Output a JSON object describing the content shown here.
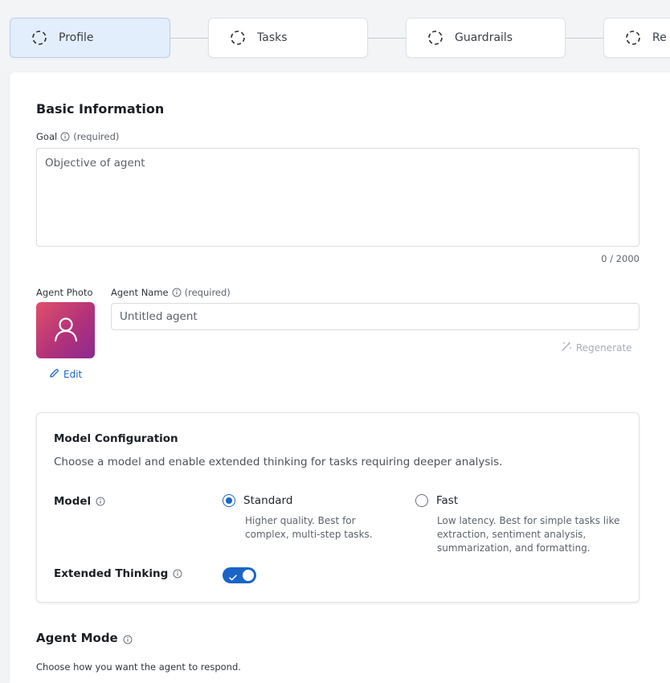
{
  "steps": [
    {
      "label": "Profile",
      "active": true
    },
    {
      "label": "Tasks",
      "active": false
    },
    {
      "label": "Guardrails",
      "active": false
    },
    {
      "label": "Re",
      "active": false
    }
  ],
  "basic_info": {
    "title": "Basic Information",
    "goal_label": "Goal",
    "goal_required": "(required)",
    "goal_placeholder": "Objective of agent",
    "goal_counter": "0 / 2000"
  },
  "agent": {
    "photo_label": "Agent Photo",
    "edit_label": "Edit",
    "name_label": "Agent Name",
    "name_required": "(required)",
    "name_placeholder": "Untitled agent",
    "regenerate_label": "Regenerate"
  },
  "model_config": {
    "title": "Model Configuration",
    "description": "Choose a model and enable extended thinking for tasks requiring deeper analysis.",
    "model_label": "Model",
    "options": [
      {
        "label": "Standard",
        "desc": "Higher quality. Best for complex, multi-step tasks.",
        "selected": true
      },
      {
        "label": "Fast",
        "desc": "Low latency. Best for simple tasks like extraction, sentiment analysis, summarization, and formatting.",
        "selected": false
      }
    ],
    "extended_thinking_label": "Extended Thinking",
    "extended_thinking_on": true
  },
  "agent_mode": {
    "title": "Agent Mode",
    "description": "Choose how you want the agent to respond."
  },
  "colors": {
    "accent": "#1a64c8",
    "active_step_bg": "#e3eefc",
    "avatar_gradient_start": "#e0506a",
    "avatar_gradient_end": "#8a2a90"
  },
  "icons": {
    "step": "dashed-circle-icon",
    "info": "info-circle-icon",
    "avatar": "user-icon",
    "edit": "pencil-icon",
    "regenerate": "magic-wand-icon"
  }
}
